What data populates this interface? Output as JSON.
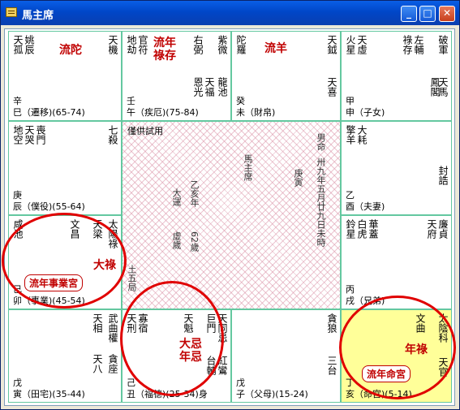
{
  "window": {
    "title": "馬主席",
    "minimize": "_",
    "maximize": "□",
    "close": "✕"
  },
  "palaces": {
    "si": {
      "bottom": "辛\n巳（遷移)(65-74)"
    },
    "wu": {
      "bottom": "壬\n午（疾厄)(75-84)"
    },
    "wei": {
      "bottom": "癸\n未（財帛)"
    },
    "shen": {
      "bottom": "甲\n申（子女)"
    },
    "chen": {
      "bottom": "庚\n辰（僕役)(55-64)"
    },
    "you": {
      "bottom": "乙\n酉（夫妻)"
    },
    "mao": {
      "bottom": "己\n卯（事業)(45-54)"
    },
    "xu": {
      "bottom": "丙\n戌（兄弟)"
    },
    "yin": {
      "bottom": "戊\n寅（田宅)(35-44)"
    },
    "chou": {
      "bottom": "己\n丑（福德)(25-34)身"
    },
    "zi": {
      "bottom": "戊\n子（父母)(15-24)"
    },
    "hai": {
      "bottom": "丁\n亥（命宮)(5-14)"
    }
  },
  "labels": {
    "liutuo": "流陀",
    "liunian_lucun": "流年祿存",
    "liuyang": "流羊",
    "dalu": "大祿",
    "daji_nianji": "大忌年忌",
    "nianlu": "年祿",
    "badge_career": "流年事業宮",
    "badge_life": "流年命宮"
  },
  "center": {
    "note": "僅供試用",
    "name": "馬主席",
    "gender": "男命",
    "zodiac": "庚寅",
    "birth": "卅九年五月廿九日未時",
    "age": "62歲",
    "year": "乙亥年",
    "daxian": "大運",
    "wuju": "土五局",
    "huidu": "虛歲"
  },
  "stars": {
    "si": [
      "天孤",
      "姚辰",
      "天機"
    ],
    "wu": [
      "地劫",
      "官符",
      "右弼",
      "紫微",
      "恩光",
      "天福",
      "龍池"
    ],
    "wei": [
      "陀羅",
      "天鉞",
      "天喜"
    ],
    "shen": [
      "火星",
      "天虛",
      "祿存",
      "左輔",
      "破軍",
      "鳳閣",
      "天馬"
    ],
    "chen": [
      "地空",
      "天哭",
      "喪門",
      "七殺"
    ],
    "you": [
      "擎羊",
      "大耗",
      "封誥"
    ],
    "mao": [
      "咸池",
      "文昌",
      "天梁",
      "太陽",
      "祿"
    ],
    "xu": [
      "鈴星",
      "白虎",
      "華蓋",
      "天府",
      "廉貞"
    ],
    "yin": [
      "天相",
      "武曲",
      "權",
      "天八",
      "貪座"
    ],
    "chou": [
      "天刑",
      "寡宿",
      "天魁",
      "巨門",
      "天同",
      "忌",
      "台輔",
      "紅鸞"
    ],
    "zi": [
      "貪狼",
      "三台"
    ],
    "hai": [
      "文曲",
      "太陰",
      "科",
      "天官"
    ]
  }
}
